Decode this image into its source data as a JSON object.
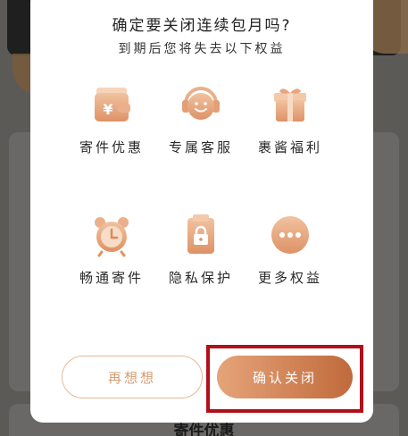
{
  "background": {
    "card_title": "寄件优惠"
  },
  "dialog": {
    "title": "确定要关闭连续包月吗?",
    "subtitle": "到期后您将失去以下权益",
    "benefits": [
      {
        "label": "寄件优惠",
        "icon": "wallet-yen-icon"
      },
      {
        "label": "专属客服",
        "icon": "customer-service-icon"
      },
      {
        "label": "裹酱福利",
        "icon": "gift-box-icon"
      },
      {
        "label": "畅通寄件",
        "icon": "alarm-clock-icon"
      },
      {
        "label": "隐私保护",
        "icon": "lock-icon"
      },
      {
        "label": "更多权益",
        "icon": "more-dots-icon"
      }
    ],
    "cancel_label": "再想想",
    "confirm_label": "确认关闭"
  },
  "colors": {
    "accent": "#c06a3c",
    "accent_light": "#e5a479",
    "highlight": "#b20f1a"
  }
}
